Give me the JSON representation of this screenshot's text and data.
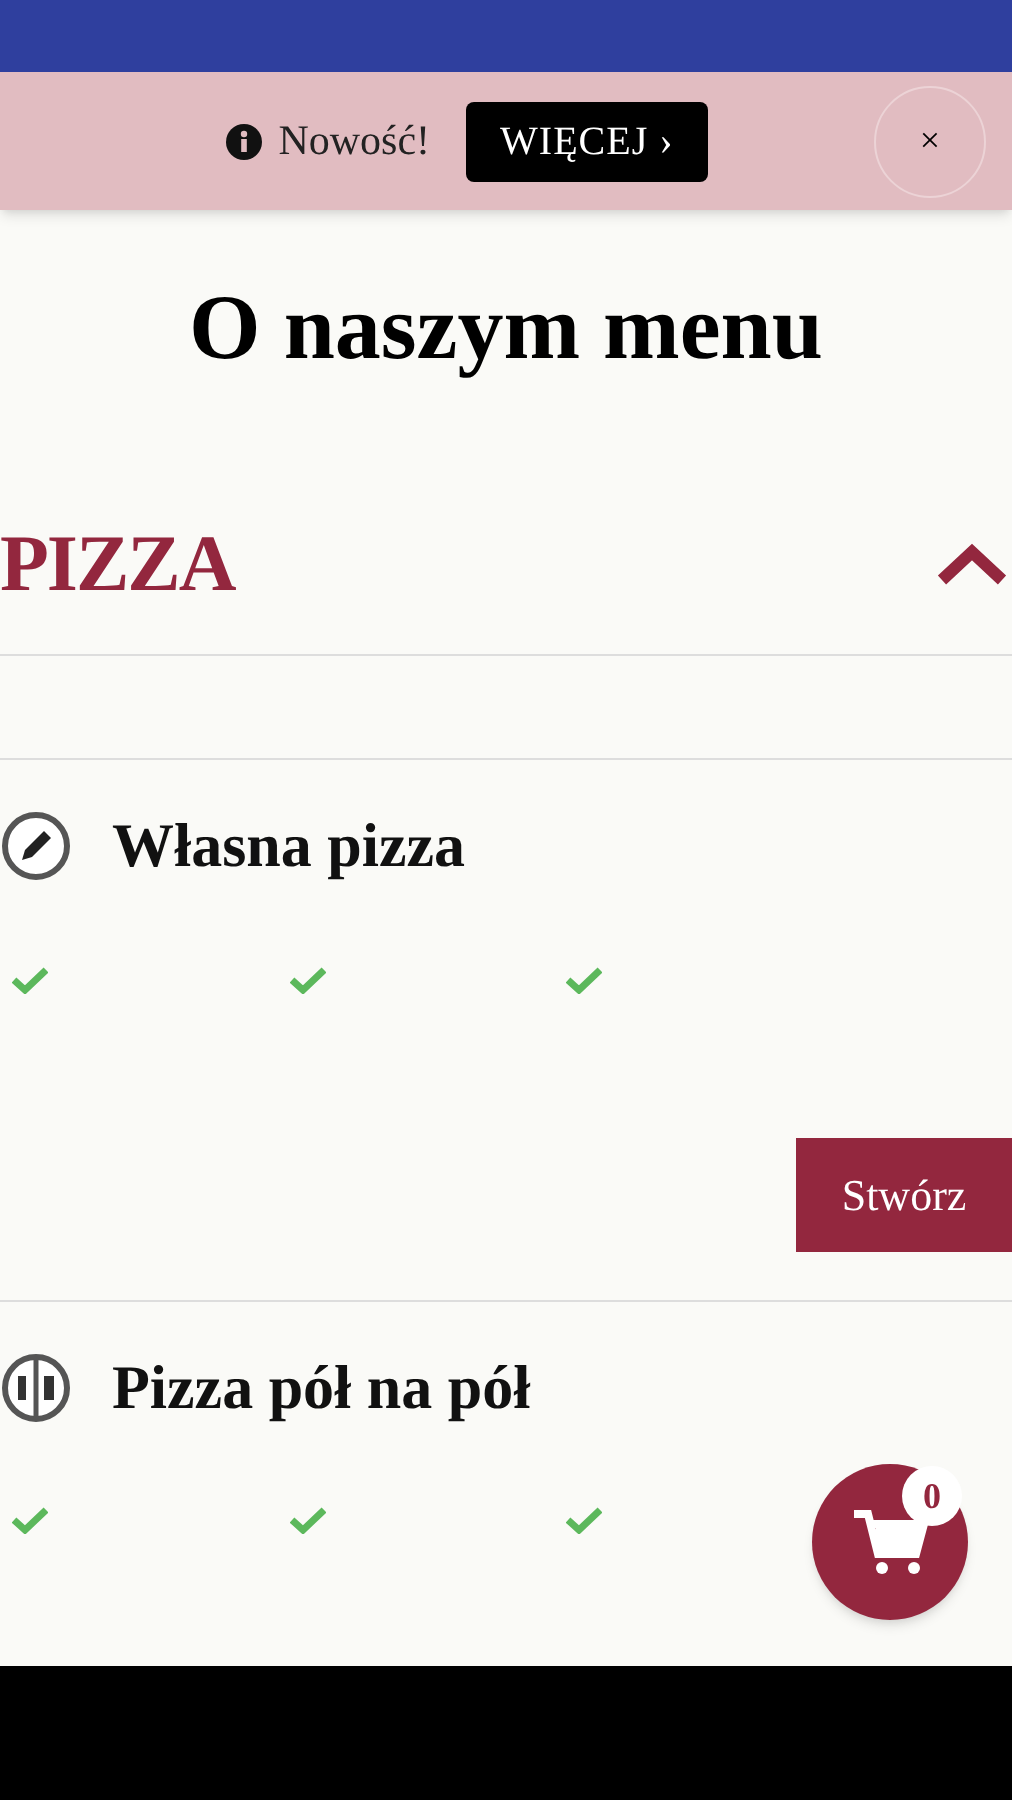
{
  "banner": {
    "label": "Nowość!",
    "button": "WIĘCEJ ›",
    "close": "×"
  },
  "intro": {
    "title": "O naszym menu"
  },
  "section": {
    "title": "PIZZA",
    "expanded": true
  },
  "items": [
    {
      "kind": "custom",
      "name": "Własna pizza",
      "button": "Stwórz"
    },
    {
      "kind": "split",
      "name": "Pizza pół na pół"
    }
  ],
  "cart": {
    "count": "0"
  }
}
